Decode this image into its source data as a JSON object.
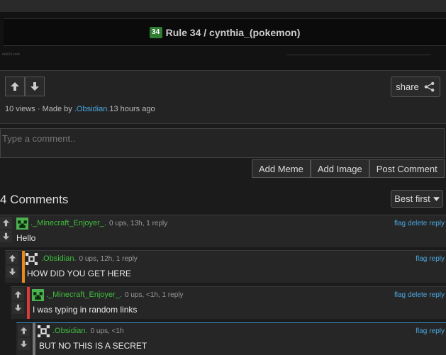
{
  "image_header": {
    "site_icon_text": "34",
    "title": "Rule 34 / cynthia_(pokemon)",
    "credit": "rule34.com"
  },
  "meme": {
    "share_label": "share",
    "views": "10 views",
    "made_by_prefix": "· Made by",
    "author": ".Obsidian.",
    "time": "13 hours ago"
  },
  "comment_form": {
    "placeholder": "Type a comment..",
    "add_meme": "Add Meme",
    "add_image": "Add Image",
    "post": "Post Comment"
  },
  "comments_section": {
    "count_label": "4 Comments",
    "sort_label": "Best first"
  },
  "comments": [
    {
      "name": "._Minecraft_Enjoyer_.",
      "stats": "0 ups, 13h, 1 reply",
      "text": "Hello",
      "links": [
        "flag",
        "delete",
        "reply"
      ],
      "bar_color": "",
      "avatar": "creeper-avatar"
    },
    {
      "name": ".Obsidian.",
      "stats": "0 ups, 12h, 1 reply",
      "text": "HOW DID YOU GET HERE",
      "links": [
        "flag",
        "reply"
      ],
      "bar_color": "#e58a1b",
      "avatar": "pixel-avatar"
    },
    {
      "name": "._Minecraft_Enjoyer_.",
      "stats": "0 ups, <1h, 1 reply",
      "text": "I was typing in random links",
      "links": [
        "flag",
        "delete",
        "reply"
      ],
      "bar_color": "#d93a3a",
      "avatar": "creeper-avatar"
    },
    {
      "name": ".Obsidian.",
      "stats": "0 ups, <1h",
      "text": "BUT NO THIS IS A SECRET",
      "links": [
        "flag",
        "reply"
      ],
      "bar_color": "#777777",
      "avatar": "pixel-avatar"
    }
  ],
  "colors": {
    "link": "#4aa8e0",
    "username": "#3fbf3f",
    "accent_orange": "#e58a1b",
    "accent_red": "#d93a3a"
  }
}
